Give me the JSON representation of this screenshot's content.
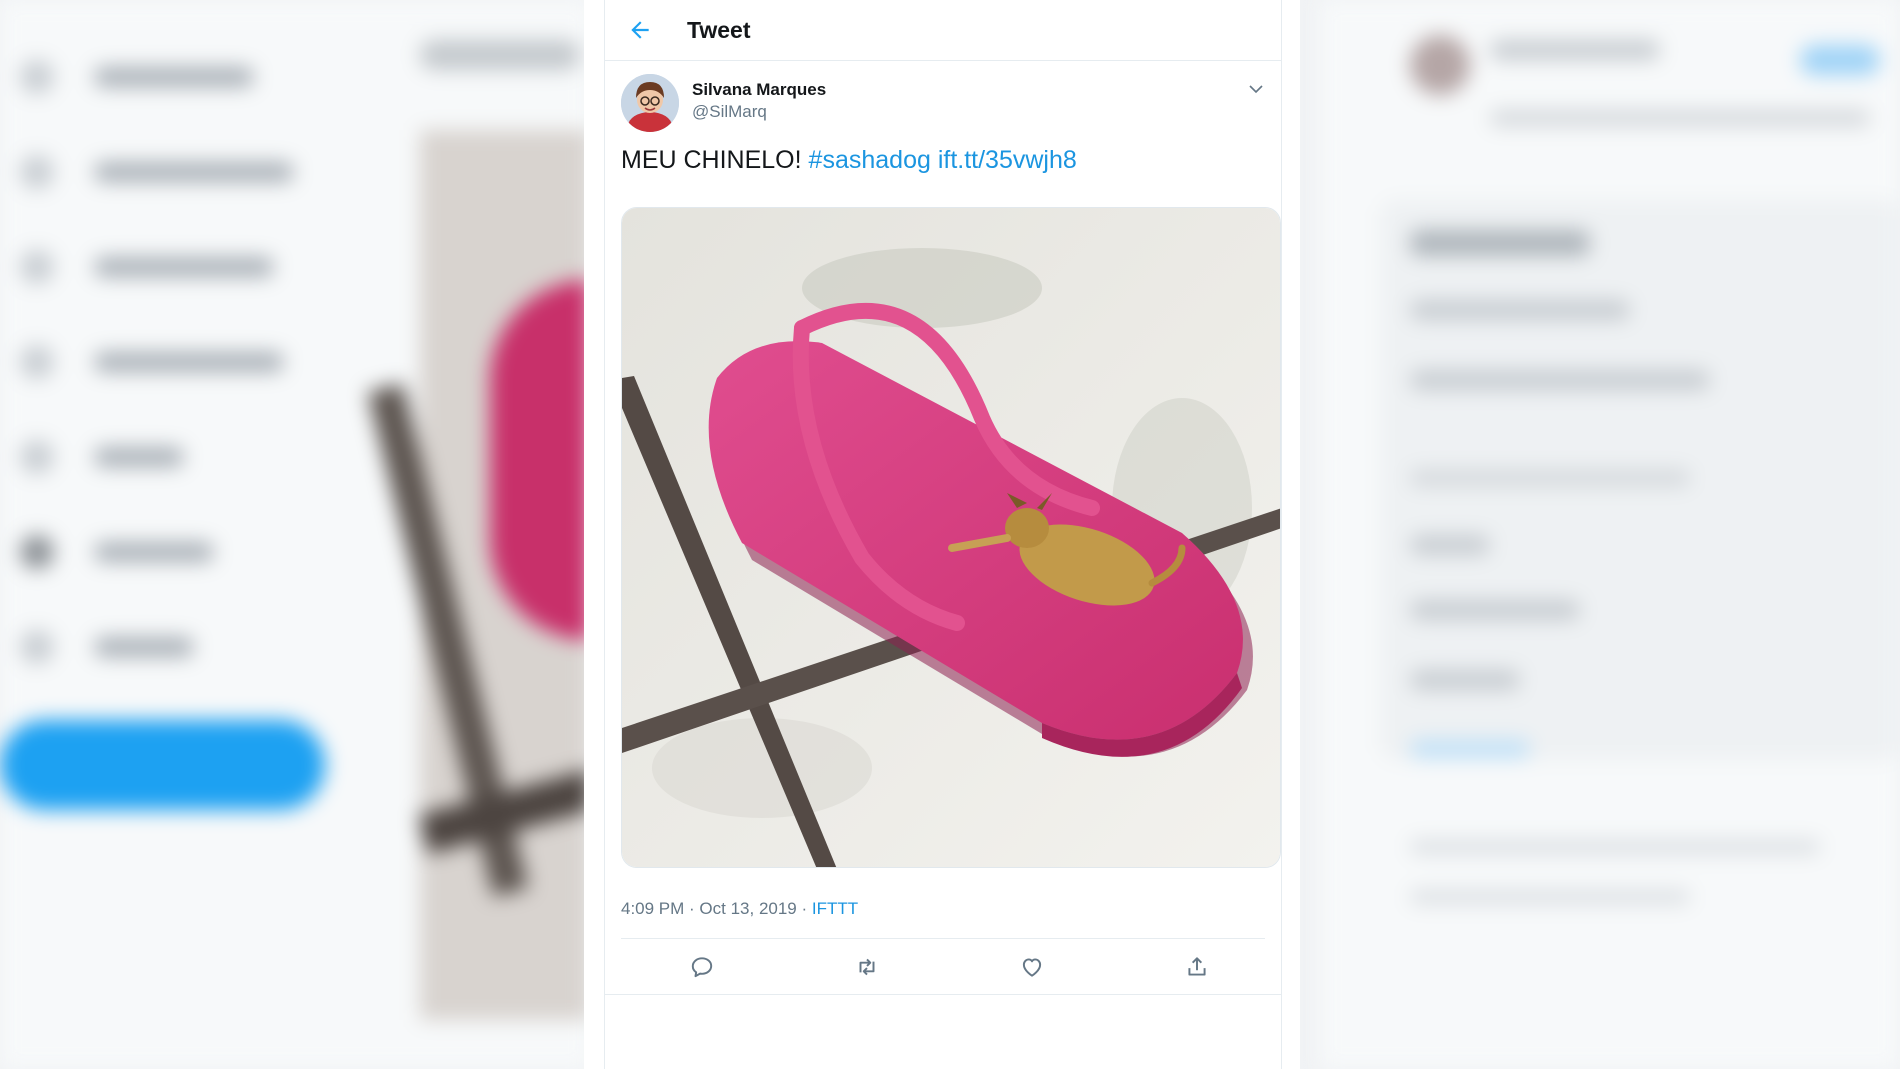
{
  "header": {
    "title": "Tweet"
  },
  "author": {
    "name": "Silvana Marques",
    "handle": "@SilMarq"
  },
  "tweet": {
    "text": "MEU CHINELO!",
    "hashtag": "#sashadog",
    "link": "ift.tt/35vwjh8"
  },
  "meta": {
    "timestamp": "4:09 PM · Oct 13, 2019 · ",
    "source": "IFTTT"
  },
  "icons": {
    "back": "back-arrow-icon",
    "menu": "chevron-down-icon",
    "reply": "reply-icon",
    "retweet": "retweet-icon",
    "like": "heart-icon",
    "share": "share-icon"
  },
  "colors": {
    "accent": "#1da1f2",
    "link": "#1b95e0",
    "muted": "#657786",
    "text": "#14171a"
  }
}
